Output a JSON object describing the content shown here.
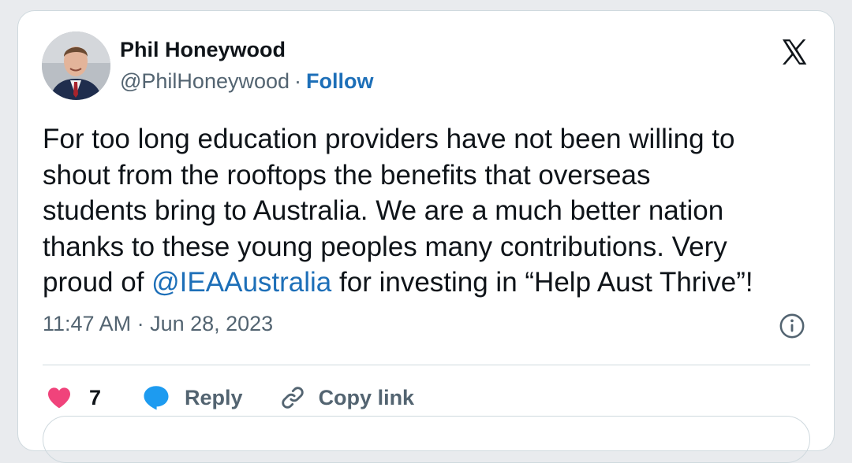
{
  "author": {
    "name": "Phil Honeywood",
    "handle": "@PhilHoneywood",
    "separator": "·",
    "follow_label": "Follow"
  },
  "tweet": {
    "lines": [
      "For too long education providers have not been willing to",
      "shout from the rooftops the benefits that overseas",
      "students bring to Australia. We are a much better nation",
      "thanks to these young peoples many contributions. Very"
    ],
    "last_line_prefix": "proud of ",
    "mention": "@IEAAustralia",
    "last_line_suffix": " for investing in “Help Aust Thrive”!",
    "timestamp": "11:47 AM · Jun 28, 2023"
  },
  "actions": {
    "like_count": "7",
    "reply_label": "Reply",
    "copy_link_label": "Copy link"
  },
  "colors": {
    "link": "#1d6fb8",
    "like": "#f0437b",
    "reply": "#1d9bf0",
    "text": "#0f1419",
    "muted": "#536471"
  },
  "icons": {
    "logo": "x-logo-icon",
    "info": "info-icon",
    "like": "heart-icon",
    "reply": "speech-bubble-icon",
    "copy": "link-icon"
  }
}
